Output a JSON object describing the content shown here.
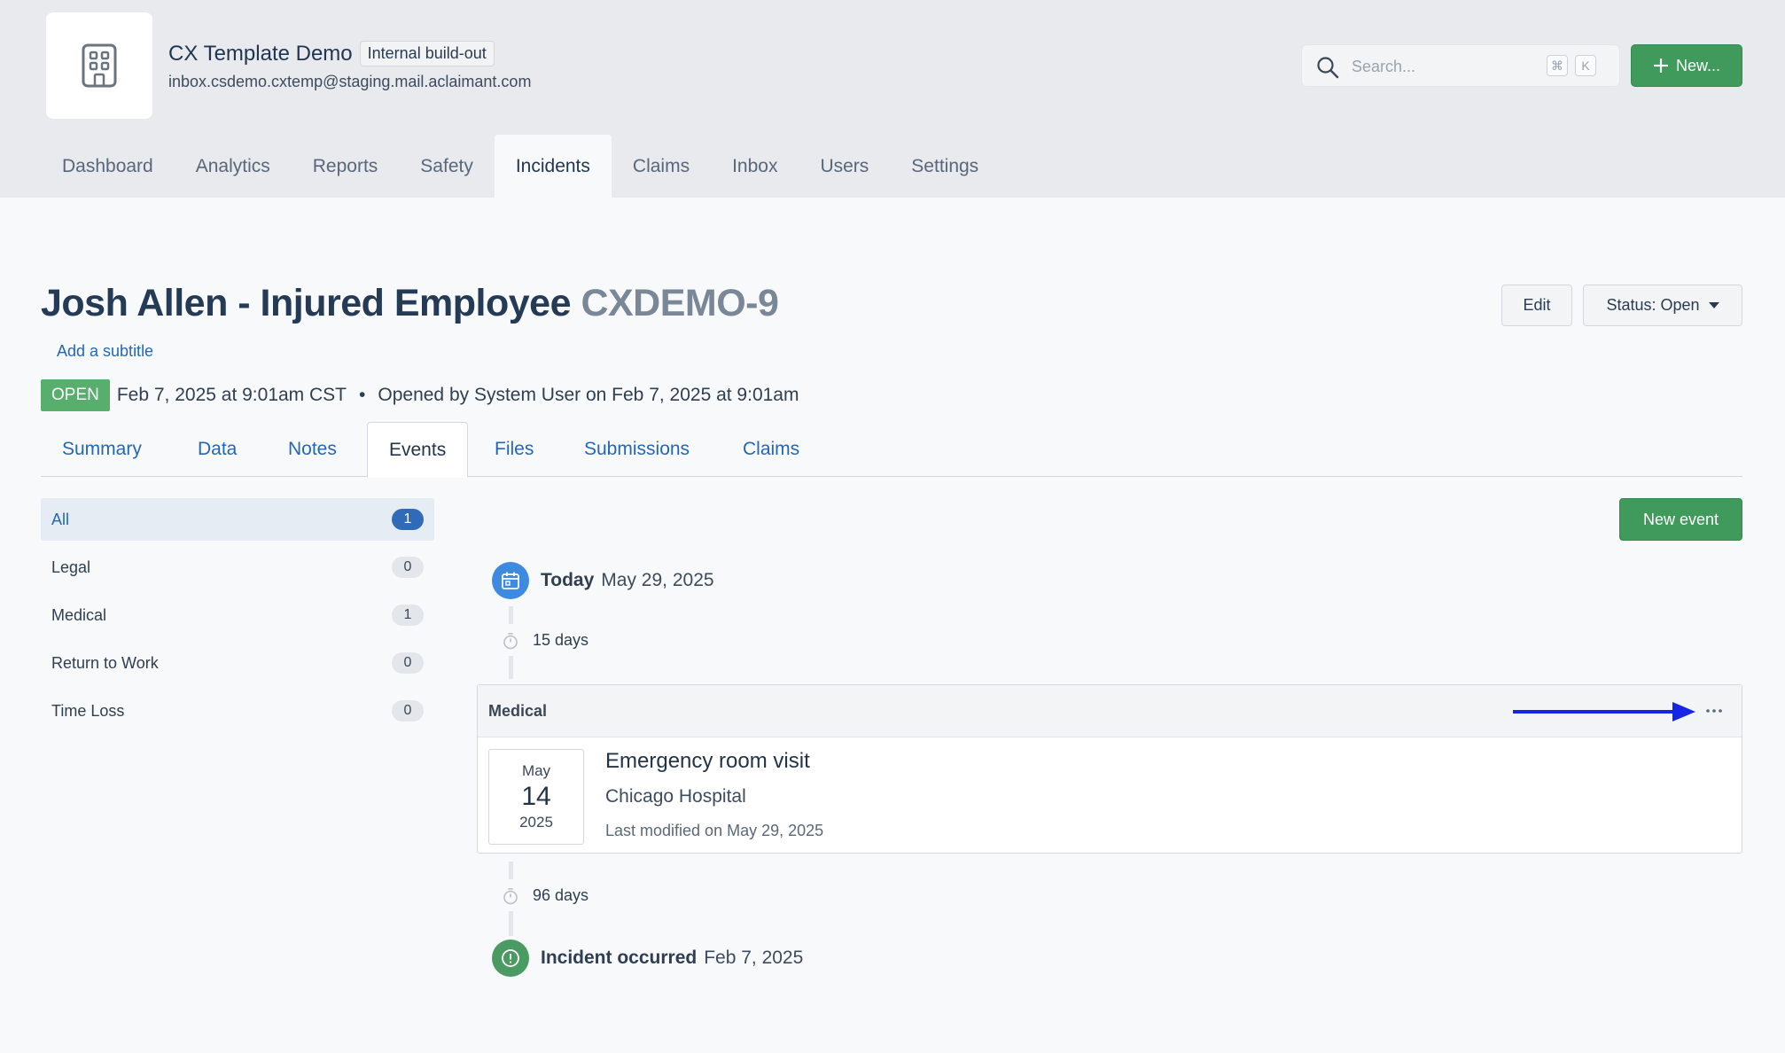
{
  "org": {
    "name": "CX Template Demo",
    "env_badge": "Internal build-out",
    "email": "inbox.csdemo.cxtemp@staging.mail.aclaimant.com",
    "logo_icon": "building-icon"
  },
  "search": {
    "placeholder": "Search...",
    "shortcut_mod": "⌘",
    "shortcut_key": "K"
  },
  "header": {
    "new_button": "New..."
  },
  "nav": [
    "Dashboard",
    "Analytics",
    "Reports",
    "Safety",
    "Incidents",
    "Claims",
    "Inbox",
    "Users",
    "Settings"
  ],
  "nav_active": "Incidents",
  "page": {
    "title": "Josh Allen - Injured Employee",
    "code": "CXDEMO-9",
    "add_subtitle": "Add a subtitle",
    "edit_button": "Edit",
    "status_button": "Status: Open",
    "status_badge": "OPEN",
    "opened_at": "Feb 7, 2025 at 9:01am CST",
    "separator": "•",
    "opened_by": "Opened by System User on Feb 7, 2025 at 9:01am"
  },
  "tabs": [
    "Summary",
    "Data",
    "Notes",
    "Events",
    "Files",
    "Submissions",
    "Claims"
  ],
  "tab_active": "Events",
  "filters": [
    {
      "label": "All",
      "count": "1",
      "active": true
    },
    {
      "label": "Legal",
      "count": "0"
    },
    {
      "label": "Medical",
      "count": "1"
    },
    {
      "label": "Return to Work",
      "count": "0"
    },
    {
      "label": "Time Loss",
      "count": "0"
    }
  ],
  "new_event_button": "New event",
  "timeline": {
    "today_label": "Today",
    "today_date": "May 29, 2025",
    "gap1": "15 days",
    "gap2": "96 days",
    "incident_label": "Incident occurred",
    "incident_date": "Feb 7, 2025"
  },
  "event": {
    "category": "Medical",
    "month": "May",
    "day": "14",
    "year": "2025",
    "title": "Emergency room visit",
    "location": "Chicago Hospital",
    "modified": "Last modified on May 29, 2025"
  },
  "colors": {
    "accent_green": "#3f9a5c",
    "link_blue": "#2367b8",
    "today_icon_blue": "#3d8ae0",
    "annotation_arrow": "#1525e8"
  }
}
